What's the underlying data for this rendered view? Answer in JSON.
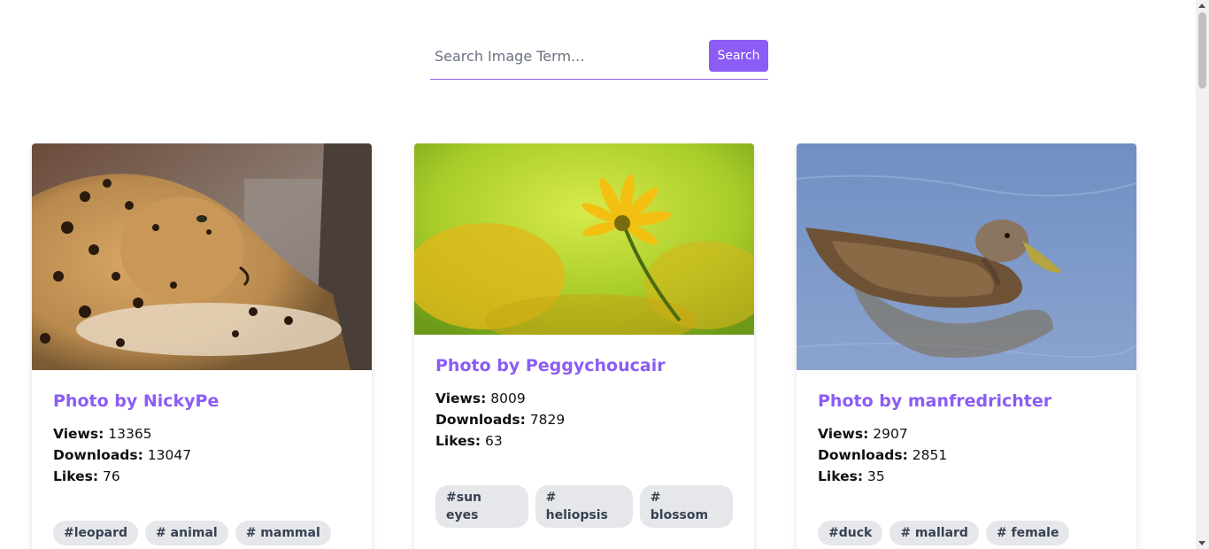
{
  "search": {
    "placeholder": "Search Image Term...",
    "value": "",
    "button_label": "Search"
  },
  "labels": {
    "views": "Views:",
    "downloads": "Downloads:",
    "likes": "Likes:"
  },
  "cards": [
    {
      "title": "Photo by NickyPe",
      "views": "13365",
      "downloads": "13047",
      "likes": "76",
      "tags": [
        "#leopard",
        "# animal",
        "# mammal"
      ],
      "image": "leopard-photo"
    },
    {
      "title": "Photo by Peggychoucair",
      "views": "8009",
      "downloads": "7829",
      "likes": "63",
      "tags": [
        "#sun eyes",
        "# heliopsis",
        "# blossom"
      ],
      "image": "yellow-flower-photo"
    },
    {
      "title": "Photo by manfredrichter",
      "views": "2907",
      "downloads": "2851",
      "likes": "35",
      "tags": [
        "#duck",
        "# mallard",
        "# female"
      ],
      "image": "duck-photo"
    }
  ],
  "colors": {
    "accent": "#8b5cf6",
    "tag_bg": "#e5e7eb",
    "tag_text": "#374151"
  }
}
